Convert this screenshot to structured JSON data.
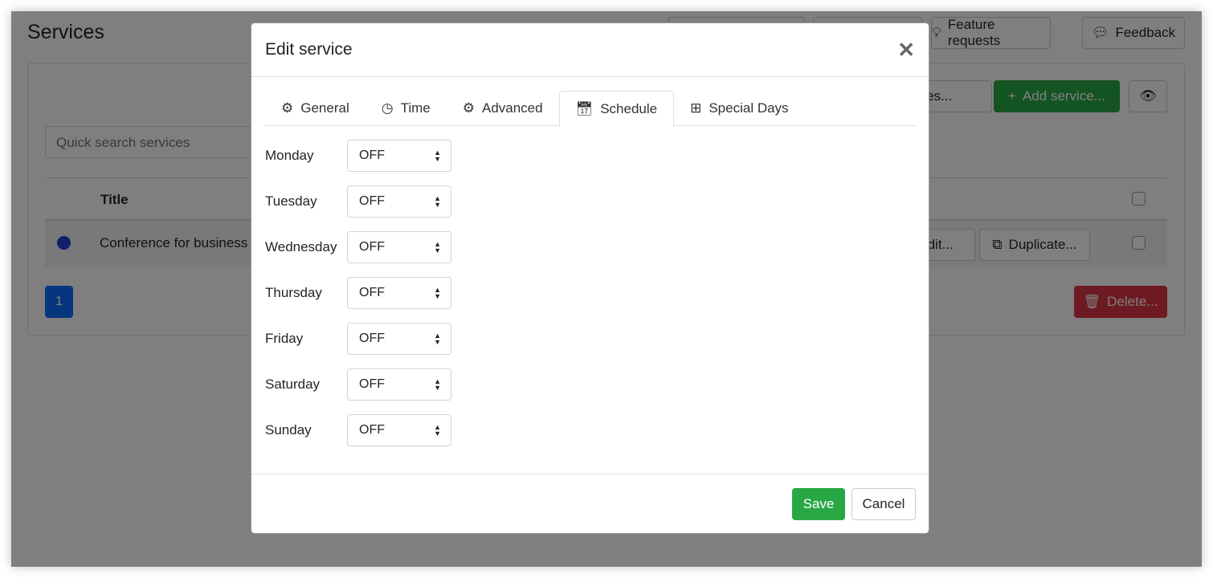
{
  "page": {
    "title": "Services",
    "header_buttons": [
      "Feature requests",
      "Feedback"
    ],
    "categories_label": "gories...",
    "add_label": "Add service...",
    "search_placeholder": "Quick search services",
    "table": {
      "column_title": "Title",
      "rows": [
        {
          "title": "Conference for business",
          "color": "#2a3cdb",
          "edit": "Edit...",
          "duplicate": "Duplicate..."
        }
      ]
    },
    "pagination": [
      "1"
    ],
    "delete_label": "Delete..."
  },
  "modal": {
    "title": "Edit service",
    "tabs": [
      {
        "label": "General",
        "icon": "gear-icon"
      },
      {
        "label": "Time",
        "icon": "clock-icon"
      },
      {
        "label": "Advanced",
        "icon": "gears-icon"
      },
      {
        "label": "Schedule",
        "icon": "calendar-icon",
        "active": true
      },
      {
        "label": "Special Days",
        "icon": "calendar-plus-icon"
      }
    ],
    "days": [
      {
        "day": "Monday",
        "value": "OFF"
      },
      {
        "day": "Tuesday",
        "value": "OFF"
      },
      {
        "day": "Wednesday",
        "value": "OFF"
      },
      {
        "day": "Thursday",
        "value": "OFF"
      },
      {
        "day": "Friday",
        "value": "OFF"
      },
      {
        "day": "Saturday",
        "value": "OFF"
      },
      {
        "day": "Sunday",
        "value": "OFF"
      }
    ],
    "save": "Save",
    "cancel": "Cancel"
  },
  "colors": {
    "success": "#28a745",
    "primary": "#0d6efd",
    "danger": "#dc3545"
  }
}
